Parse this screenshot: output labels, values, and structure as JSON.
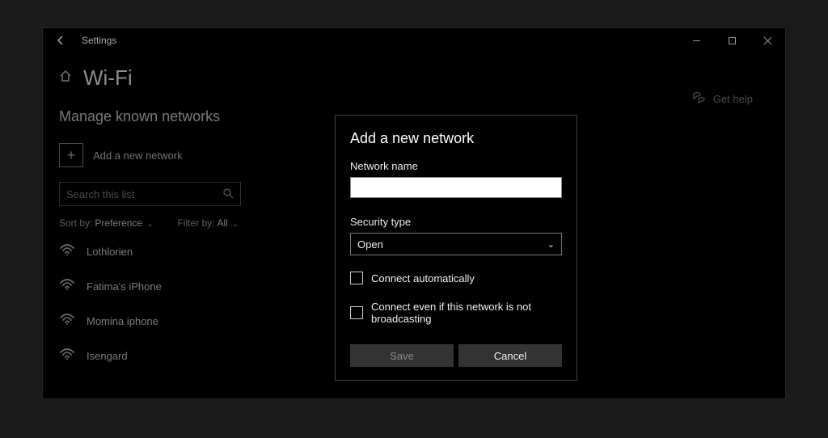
{
  "window": {
    "app_title": "Settings",
    "page_title": "Wi-Fi",
    "sub_title": "Manage known networks"
  },
  "add_network": {
    "label": "Add a new network"
  },
  "search": {
    "placeholder": "Search this list"
  },
  "filters": {
    "sort_label": "Sort by:",
    "sort_value": "Preference",
    "filter_label": "Filter by:",
    "filter_value": "All"
  },
  "networks": [
    {
      "name": "Lothlorien"
    },
    {
      "name": "Fatima's iPhone"
    },
    {
      "name": "Momina iphone"
    },
    {
      "name": "Isengard"
    }
  ],
  "help": {
    "label": "Get help"
  },
  "dialog": {
    "title": "Add a new network",
    "network_name_label": "Network name",
    "network_name_value": "",
    "security_type_label": "Security type",
    "security_type_value": "Open",
    "connect_auto_label": "Connect automatically",
    "connect_hidden_label": "Connect even if this network is not broadcasting",
    "save_label": "Save",
    "cancel_label": "Cancel"
  }
}
